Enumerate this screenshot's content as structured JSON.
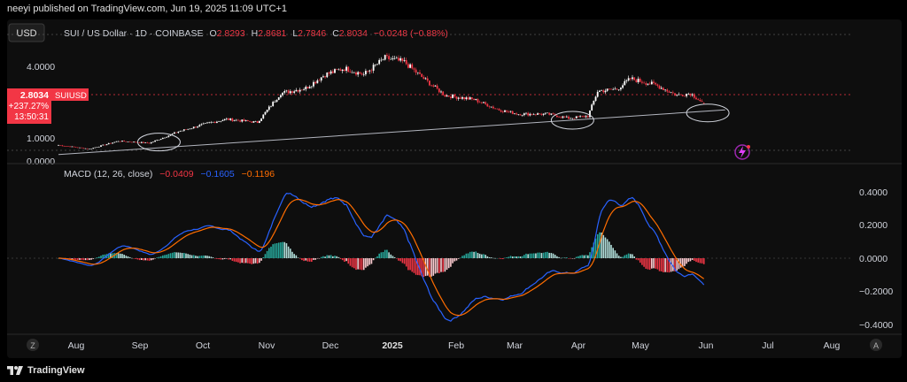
{
  "header": {
    "published": "neeyi published on TradingView.com, Jun 19, 2025 11:09 UTC+1"
  },
  "footer": {
    "brand": "TradingView",
    "logo_icon": "tradingview-logo-icon"
  },
  "toolbar": {
    "currency": "USD"
  },
  "price_pane": {
    "symbol_line": "SUI / US Dollar · 1D · COINBASE",
    "ohlc": [
      {
        "key": "O",
        "value": "2.8293"
      },
      {
        "key": "H",
        "value": "2.8681"
      },
      {
        "key": "L",
        "value": "2.7846"
      },
      {
        "key": "C",
        "value": "2.8034"
      }
    ],
    "change": "−0.0248 (−0.88%)",
    "axis_labels": [
      "4.0000",
      "1.0000",
      "0.0000"
    ],
    "badge": {
      "symbol": "SUIUSD",
      "price": "2.8034",
      "change": "+237.27%",
      "countdown": "13:50:31"
    },
    "colors": {
      "up": "#ffffff",
      "down": "#f23645",
      "trendline": "#b2b5be",
      "ellipse": "#d1d4dc"
    }
  },
  "macd_pane": {
    "title": "MACD (12, 26, close)",
    "values": [
      {
        "value": "−0.0409",
        "color": "#f23645"
      },
      {
        "value": "−0.1605",
        "color": "#2962ff"
      },
      {
        "value": "−0.1196",
        "color": "#ff6d00"
      }
    ],
    "axis_labels": [
      "0.4000",
      "0.2000",
      "0.0000",
      "−0.2000",
      "−0.4000"
    ]
  },
  "time_axis": [
    "Aug",
    "Sep",
    "Oct",
    "Nov",
    "Dec",
    "2025",
    "Feb",
    "Mar",
    "Apr",
    "May",
    "Jun",
    "Jul",
    "Aug"
  ],
  "buttons": {
    "z": "Z",
    "a": "A"
  },
  "chart_data": [
    {
      "type": "candlestick",
      "title": "SUI / US Dollar · 1D · COINBASE",
      "ylabel": "USD",
      "ylim": [
        0,
        6
      ],
      "x_range": [
        "2024-07-20",
        "2025-08-31"
      ],
      "anchor_closes": [
        {
          "date": "2024-07-20",
          "close": 0.8
        },
        {
          "date": "2024-08-05",
          "close": 0.62
        },
        {
          "date": "2024-08-20",
          "close": 1.0
        },
        {
          "date": "2024-09-05",
          "close": 0.9
        },
        {
          "date": "2024-09-20",
          "close": 1.45
        },
        {
          "date": "2024-10-05",
          "close": 1.85
        },
        {
          "date": "2024-10-15",
          "close": 2.05
        },
        {
          "date": "2024-10-31",
          "close": 1.9
        },
        {
          "date": "2024-11-12",
          "close": 3.3
        },
        {
          "date": "2024-11-25",
          "close": 3.55
        },
        {
          "date": "2024-12-05",
          "close": 4.2
        },
        {
          "date": "2024-12-15",
          "close": 4.5
        },
        {
          "date": "2024-12-25",
          "close": 4.2
        },
        {
          "date": "2025-01-05",
          "close": 5.0
        },
        {
          "date": "2025-01-15",
          "close": 4.8
        },
        {
          "date": "2025-01-25",
          "close": 4.0
        },
        {
          "date": "2025-02-05",
          "close": 3.2
        },
        {
          "date": "2025-02-20",
          "close": 3.0
        },
        {
          "date": "2025-03-05",
          "close": 2.5
        },
        {
          "date": "2025-03-15",
          "close": 2.3
        },
        {
          "date": "2025-03-30",
          "close": 2.3
        },
        {
          "date": "2025-04-10",
          "close": 2.1
        },
        {
          "date": "2025-04-20",
          "close": 2.2
        },
        {
          "date": "2025-04-25",
          "close": 3.4
        },
        {
          "date": "2025-05-05",
          "close": 3.5
        },
        {
          "date": "2025-05-12",
          "close": 4.0
        },
        {
          "date": "2025-05-25",
          "close": 3.7
        },
        {
          "date": "2025-06-05",
          "close": 3.2
        },
        {
          "date": "2025-06-12",
          "close": 3.3
        },
        {
          "date": "2025-06-19",
          "close": 2.8
        }
      ],
      "trendline": [
        {
          "date": "2024-07-20",
          "value": 0.35
        },
        {
          "date": "2025-06-30",
          "value": 2.5
        }
      ],
      "annotations": [
        {
          "shape": "ellipse",
          "date": "2024-09-10",
          "value": 0.95
        },
        {
          "shape": "ellipse",
          "date": "2025-04-12",
          "value": 2.0
        },
        {
          "shape": "ellipse",
          "date": "2025-06-21",
          "value": 2.35
        }
      ],
      "last": {
        "open": 2.8293,
        "high": 2.8681,
        "low": 2.7846,
        "close": 2.8034,
        "change": -0.0248,
        "change_pct": -0.88
      }
    },
    {
      "type": "macd",
      "title": "MACD (12, 26, close)",
      "params": {
        "fast": 12,
        "slow": 26,
        "signal": 9
      },
      "ylim": [
        -0.4,
        0.45
      ],
      "last": {
        "histogram": -0.0409,
        "macd": -0.1605,
        "signal": -0.1196
      },
      "colors": {
        "macd": "#2962ff",
        "signal": "#ff6d00",
        "hist_pos": "#26a69a",
        "hist_neg": "#f23645"
      }
    }
  ]
}
